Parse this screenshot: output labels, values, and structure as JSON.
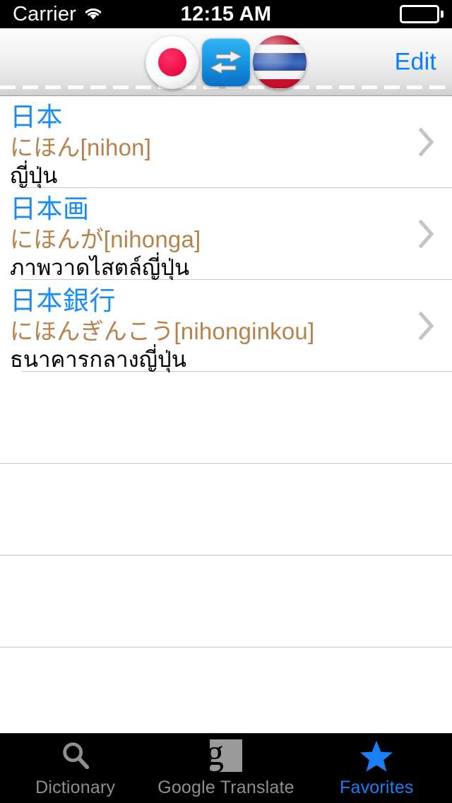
{
  "status_bar": {
    "carrier": "Carrier",
    "time": "12:15 AM",
    "wifi_icon": "wifi-icon",
    "battery_icon": "battery-icon"
  },
  "nav_bar": {
    "source_flag": "japan-flag-icon",
    "swap_icon": "swap-arrows-icon",
    "target_flag": "thailand-flag-icon",
    "edit_label": "Edit"
  },
  "list": {
    "entries": [
      {
        "headword": "日本",
        "reading": "にほん[nihon]",
        "meaning": "ญี่ปุ่น",
        "disclosure": "chevron-right-icon"
      },
      {
        "headword": "日本画",
        "reading": "にほんが[nihonga]",
        "meaning": "ภาพวาดไสตล์ญี่ปุ่น",
        "disclosure": "chevron-right-icon"
      },
      {
        "headword": "日本銀行",
        "reading": "にほんぎんこう[nihonginkou]",
        "meaning": "ธนาคารกลางญี่ปุ่น",
        "disclosure": "chevron-right-icon"
      }
    ],
    "empty_row_count": 4
  },
  "tab_bar": {
    "tabs": [
      {
        "label": "Dictionary",
        "icon": "search-icon",
        "active": false
      },
      {
        "label": "Google Translate",
        "icon": "google-g-icon",
        "active": false
      },
      {
        "label": "Favorites",
        "icon": "star-icon",
        "active": true
      }
    ]
  },
  "colors": {
    "accent_blue": "#0a7cff",
    "headword_blue": "#1a8cf0",
    "reading_brown": "#b5824a",
    "tab_inactive": "#8e8e93",
    "tab_active": "#1a7ef5",
    "separator": "#c8c8c8",
    "status_bar_bg": "#000000"
  }
}
